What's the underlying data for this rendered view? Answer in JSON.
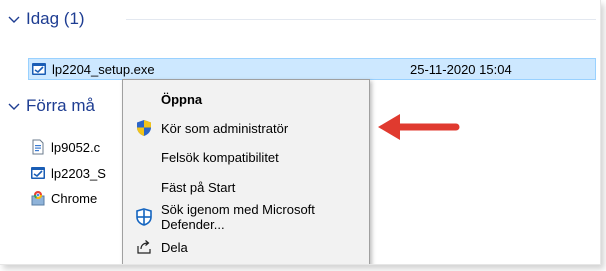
{
  "groups": {
    "today": {
      "label": "Idag (1)"
    },
    "earlier": {
      "label": "Förra må"
    }
  },
  "files": {
    "selected": {
      "name": "lp2204_setup.exe",
      "date": "25-11-2020 15:04"
    },
    "items": [
      {
        "name": "lp9052.c"
      },
      {
        "name": "lp2203_S"
      },
      {
        "name": "Chrome"
      }
    ]
  },
  "context_menu": {
    "items": [
      {
        "label": "Öppna"
      },
      {
        "label": "Kör som administratör"
      },
      {
        "label": "Felsök kompatibilitet"
      },
      {
        "label": "Fäst på Start"
      },
      {
        "label": "Sök igenom med Microsoft Defender..."
      },
      {
        "label": "Dela"
      }
    ]
  },
  "colors": {
    "group_header": "#1e3d92",
    "selection_bg": "#cde8ff",
    "menu_bg": "#f2f2f2",
    "annotation_arrow": "#e03a2f"
  }
}
